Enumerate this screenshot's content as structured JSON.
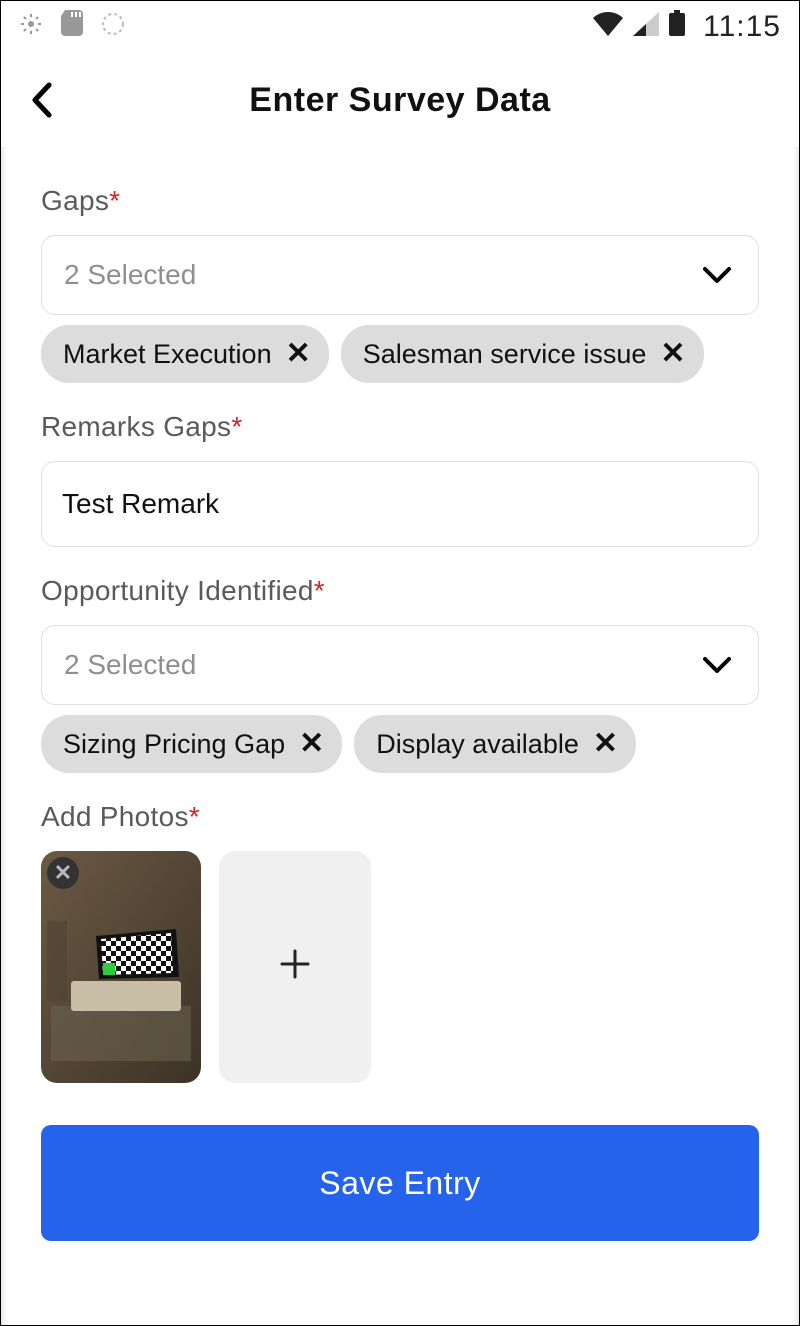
{
  "statusbar": {
    "time": "11:15"
  },
  "header": {
    "title": "Enter Survey Data"
  },
  "gaps": {
    "label": "Gaps",
    "required": true,
    "selected_text": "2 Selected",
    "chips": [
      "Market Execution",
      "Salesman service issue"
    ]
  },
  "remarks_gaps": {
    "label": "Remarks Gaps",
    "required": true,
    "value": "Test Remark"
  },
  "opportunity": {
    "label": "Opportunity Identified",
    "required": true,
    "selected_text": "2 Selected",
    "chips": [
      "Sizing Pricing Gap",
      "Display available"
    ]
  },
  "photos": {
    "label": "Add Photos",
    "required": true,
    "count": 1
  },
  "save": {
    "label": "Save Entry"
  }
}
